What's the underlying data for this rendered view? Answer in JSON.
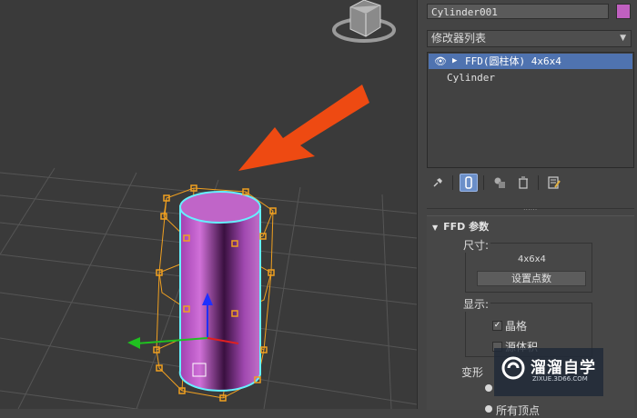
{
  "viewport": {
    "view_cube_icon": "view-cube-icon",
    "arrow_color": "#ee4a12",
    "cylinder_color": "#b64cc0",
    "lattice_color": "#f0a020"
  },
  "panel": {
    "object_name": "Cylinder001",
    "object_color": "#c060c0",
    "modifier_list_label": "修改器列表",
    "stack": {
      "ffd_item": "FFD(圆柱体) 4x6x4",
      "cylinder_item": "Cylinder"
    },
    "toolbar_icons": [
      "pin-stack-icon",
      "show-end-result-icon",
      "make-unique-icon",
      "remove-modifier-icon",
      "configure-modifier-sets-icon"
    ],
    "rollout": {
      "title": "FFD 参数",
      "size_group_label": "尺寸:",
      "dimensions": "4x6x4",
      "set_points_button": "设置点数",
      "display_group_label": "显示:",
      "lattice_label": "晶格",
      "lattice_checked": true,
      "source_volume_label": "源体积",
      "source_volume_checked": false,
      "deform_label": "变形",
      "all_vertices_label": "所有顶点"
    }
  },
  "watermark": {
    "title": "溜溜自学",
    "subtitle": "ZIXUE.3D66.COM"
  }
}
